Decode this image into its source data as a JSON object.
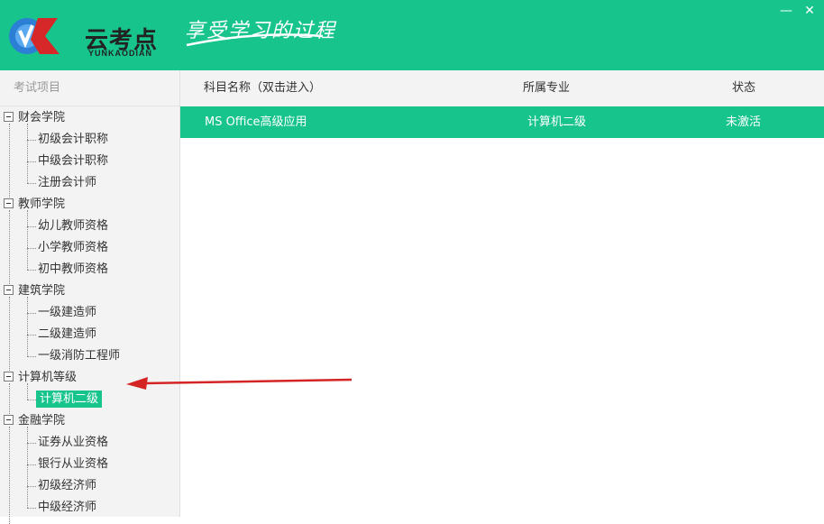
{
  "app": {
    "logo_cn": "云考点",
    "logo_en": "YUNKAODIAN",
    "slogan": "享受学习的过程",
    "minimize_glyph": "—",
    "close_glyph": "✕",
    "accent_color": "#17c48c"
  },
  "sidebar": {
    "title": "考试项目",
    "groups": [
      {
        "label": "财会学院",
        "items": [
          "初级会计职称",
          "中级会计职称",
          "注册会计师"
        ]
      },
      {
        "label": "教师学院",
        "items": [
          "幼儿教师资格",
          "小学教师资格",
          "初中教师资格"
        ]
      },
      {
        "label": "建筑学院",
        "items": [
          "一级建造师",
          "二级建造师",
          "一级消防工程师"
        ]
      },
      {
        "label": "计算机等级",
        "items": [
          "计算机二级"
        ]
      },
      {
        "label": "金融学院",
        "items": [
          "证券从业资格",
          "银行从业资格",
          "初级经济师",
          "中级经济师"
        ]
      }
    ],
    "selected_item": "计算机二级"
  },
  "table": {
    "headers": [
      "科目名称（双击进入）",
      "所属专业",
      "状态"
    ],
    "rows": [
      {
        "name": "MS Office高级应用",
        "major": "计算机二级",
        "status": "未激活",
        "selected": true
      }
    ]
  }
}
